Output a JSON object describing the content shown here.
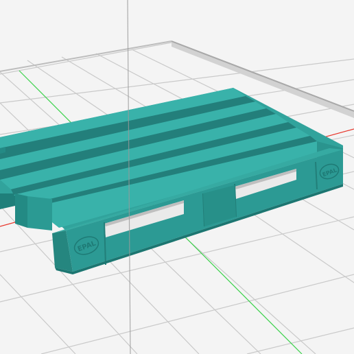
{
  "viewport": {
    "kind": "3d-model-viewer",
    "background_color": "#f4f4f4",
    "grid_color": "#c8c8c8",
    "x_axis_color": "#e8352a",
    "y_axis_color": "#3ad24a",
    "z_axis_color": "#9a9a9a"
  },
  "model": {
    "name": "EPAL pallet",
    "color": "#2f9e98",
    "color_dark": "#1f7f7a",
    "color_light": "#3fb7af",
    "emboss_text": "EPAL"
  }
}
